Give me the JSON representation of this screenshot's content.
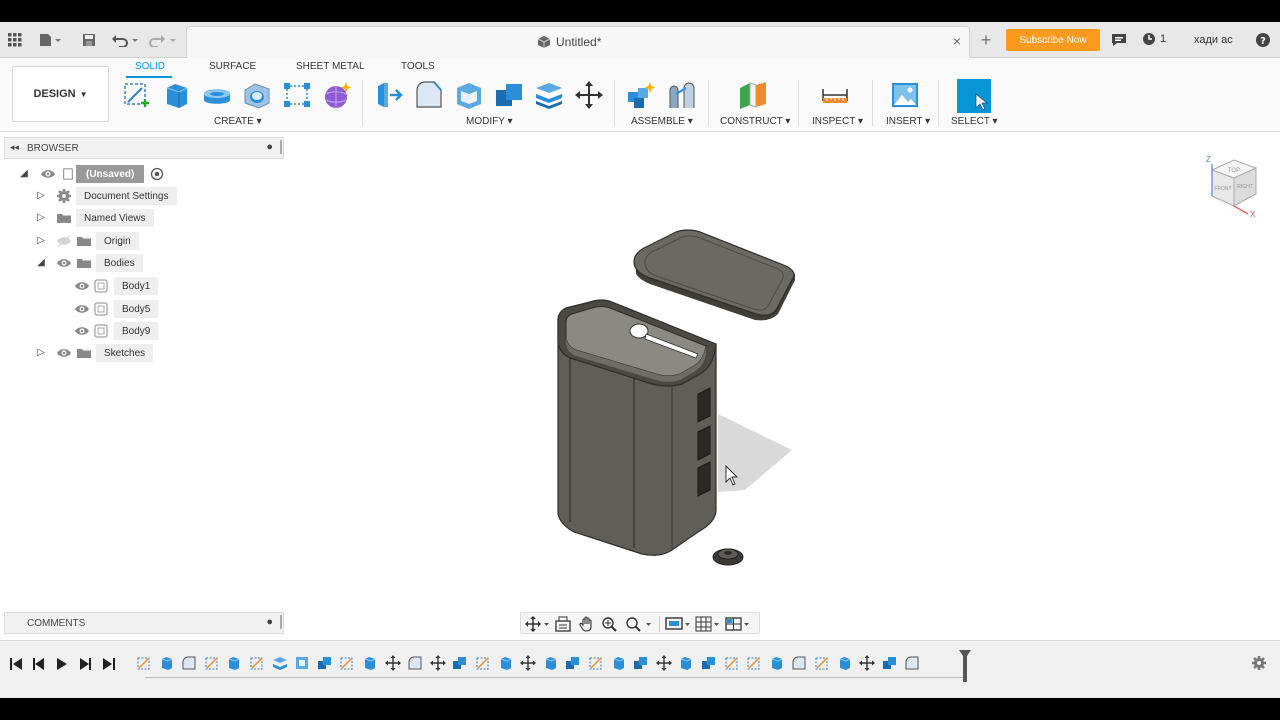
{
  "window": {
    "doc_title": "Untitled*",
    "subscribe_label": "Subscribe Now",
    "job_count": "1",
    "user_name": "хади ас",
    "close_glyph": "×",
    "add_glyph": "+"
  },
  "ribbon": {
    "workspace": "DESIGN",
    "tabs": [
      "SOLID",
      "SURFACE",
      "SHEET METAL",
      "TOOLS"
    ],
    "active_tab": "SOLID",
    "groups": [
      "CREATE",
      "MODIFY",
      "ASSEMBLE",
      "CONSTRUCT",
      "INSPECT",
      "INSERT",
      "SELECT"
    ],
    "icons": {
      "create": [
        "create-sketch-icon",
        "extrude-icon",
        "revolve-icon",
        "hole-icon",
        "pattern-icon",
        "form-icon"
      ],
      "modify": [
        "press-pull-icon",
        "fillet-icon",
        "shell-icon",
        "combine-icon",
        "split-body-icon",
        "move-icon"
      ],
      "assemble": [
        "new-component-icon",
        "joint-icon"
      ],
      "construct": [
        "offset-plane-icon"
      ],
      "inspect": [
        "measure-icon"
      ],
      "insert": [
        "insert-image-icon"
      ],
      "select": [
        "select-icon"
      ]
    }
  },
  "browser": {
    "title": "BROWSER",
    "root": "(Unsaved)",
    "items": [
      {
        "label": "Document Settings",
        "icon": "gear-icon"
      },
      {
        "label": "Named Views",
        "icon": "folder-icon"
      },
      {
        "label": "Origin",
        "icon": "folder-icon"
      },
      {
        "label": "Bodies",
        "icon": "folder-icon"
      },
      {
        "label": "Sketches",
        "icon": "folder-icon"
      }
    ],
    "bodies": [
      "Body1",
      "Body5",
      "Body9"
    ]
  },
  "comments": {
    "title": "COMMENTS"
  },
  "viewcube": {
    "top": "TOP",
    "front": "FRONT",
    "right": "RIGHT",
    "z": "Z",
    "x": "X"
  },
  "timeline": {
    "controls": [
      "skip-start-icon",
      "step-back-icon",
      "play-icon",
      "step-forward-icon",
      "skip-end-icon"
    ]
  },
  "colors": {
    "accent": "#0696d7",
    "subscribe": "#ff9a1f",
    "model_body": "#5f5e58",
    "shadow": "#d9d9d9"
  }
}
